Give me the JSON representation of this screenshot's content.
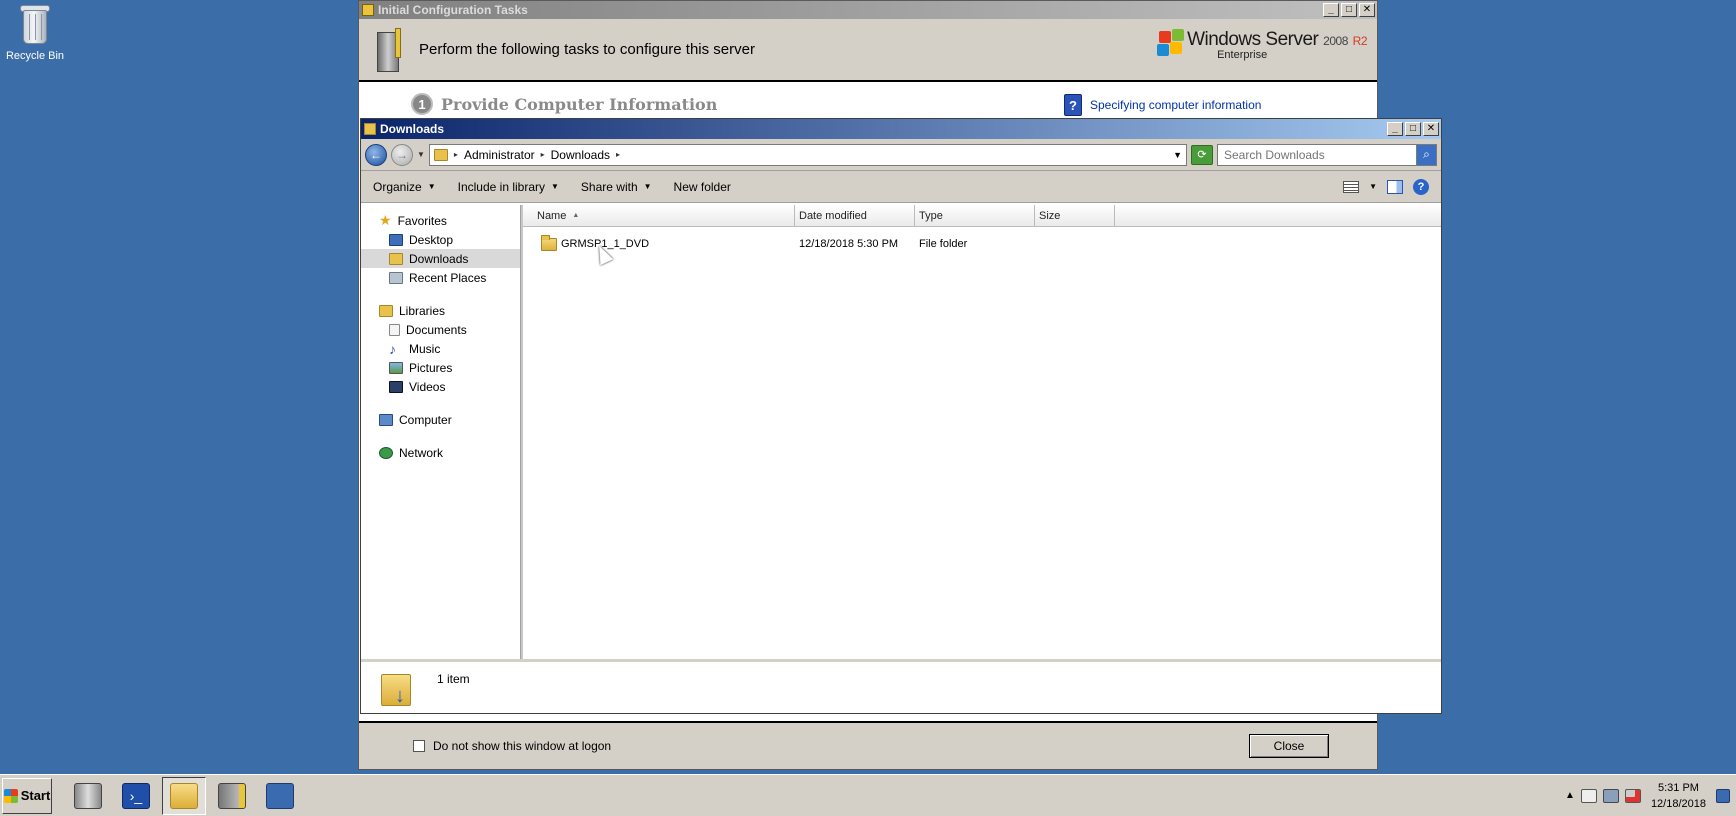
{
  "desktop": {
    "recycle_bin_label": "Recycle Bin"
  },
  "initial_config": {
    "title": "Initial Configuration Tasks",
    "header_text": "Perform the following tasks to configure this server",
    "logo": {
      "product": "Windows Server",
      "version": "2008",
      "release": "R2",
      "edition": "Enterprise"
    },
    "step_number": "1",
    "step_title": "Provide Computer Information",
    "help_link": "Specifying computer information",
    "dont_show_label": "Do not show this window at logon",
    "close_label": "Close"
  },
  "explorer": {
    "title": "Downloads",
    "breadcrumb": [
      "Administrator",
      "Downloads"
    ],
    "search_placeholder": "Search Downloads",
    "commands": {
      "organize": "Organize",
      "include_in_library": "Include in library",
      "share_with": "Share with",
      "new_folder": "New folder"
    },
    "nav": {
      "favorites": "Favorites",
      "desktop": "Desktop",
      "downloads": "Downloads",
      "recent_places": "Recent Places",
      "libraries": "Libraries",
      "documents": "Documents",
      "music": "Music",
      "pictures": "Pictures",
      "videos": "Videos",
      "computer": "Computer",
      "network": "Network"
    },
    "columns": {
      "name": "Name",
      "date_modified": "Date modified",
      "type": "Type",
      "size": "Size"
    },
    "files": [
      {
        "name": "GRMSP1_1_DVD",
        "date_modified": "12/18/2018 5:30 PM",
        "type": "File folder",
        "size": ""
      }
    ],
    "status_count": "1 item"
  },
  "taskbar": {
    "start_label": "Start",
    "time": "5:31 PM",
    "date": "12/18/2018"
  },
  "colors": {
    "desktop_bg": "#3b6ea8",
    "active_title": "#0a246a",
    "chrome": "#d4d0c8"
  }
}
